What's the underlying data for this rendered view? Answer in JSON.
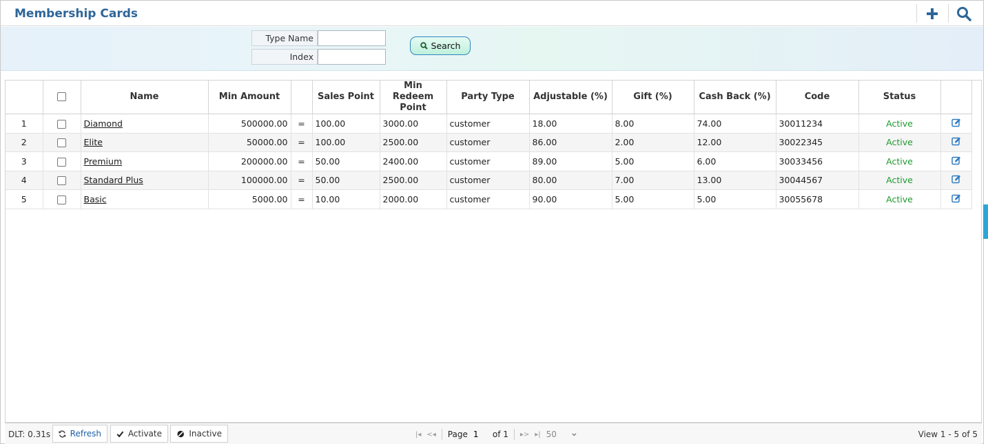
{
  "header": {
    "title": "Membership Cards",
    "add_icon": "plus-icon",
    "search_icon": "search-icon"
  },
  "search_panel": {
    "fields": [
      {
        "label": "Type Name",
        "value": ""
      },
      {
        "label": "Index",
        "value": ""
      }
    ],
    "search_button": "Search"
  },
  "table": {
    "columns": [
      "",
      "",
      "Name",
      "Min Amount",
      "",
      "Sales Point",
      "Min Redeem Point",
      "Party Type",
      "Adjustable (%)",
      "Gift (%)",
      "Cash Back (%)",
      "Code",
      "Status",
      ""
    ],
    "rows": [
      {
        "n": "1",
        "name": "Diamond",
        "min_amount": "500000.00",
        "eq": "=",
        "sales_point": "100.00",
        "min_redeem": "3000.00",
        "party_type": "customer",
        "adjustable": "18.00",
        "gift": "8.00",
        "cash_back": "74.00",
        "code": "30011234",
        "status": "Active"
      },
      {
        "n": "2",
        "name": "Elite",
        "min_amount": "50000.00",
        "eq": "=",
        "sales_point": "100.00",
        "min_redeem": "2500.00",
        "party_type": "customer",
        "adjustable": "86.00",
        "gift": "2.00",
        "cash_back": "12.00",
        "code": "30022345",
        "status": "Active"
      },
      {
        "n": "3",
        "name": "Premium",
        "min_amount": "200000.00",
        "eq": "=",
        "sales_point": "50.00",
        "min_redeem": "2400.00",
        "party_type": "customer",
        "adjustable": "89.00",
        "gift": "5.00",
        "cash_back": "6.00",
        "code": "30033456",
        "status": "Active"
      },
      {
        "n": "4",
        "name": "Standard Plus",
        "min_amount": "100000.00",
        "eq": "=",
        "sales_point": "50.00",
        "min_redeem": "2500.00",
        "party_type": "customer",
        "adjustable": "80.00",
        "gift": "7.00",
        "cash_back": "13.00",
        "code": "30044567",
        "status": "Active"
      },
      {
        "n": "5",
        "name": "Basic",
        "min_amount": "5000.00",
        "eq": "=",
        "sales_point": "10.00",
        "min_redeem": "2000.00",
        "party_type": "customer",
        "adjustable": "90.00",
        "gift": "5.00",
        "cash_back": "5.00",
        "code": "30055678",
        "status": "Active"
      }
    ]
  },
  "footer": {
    "dlt": "DLT: 0.31s",
    "refresh": "Refresh",
    "activate": "Activate",
    "inactive": "Inactive",
    "page_label": "Page",
    "page_value": "1",
    "of_label": "of 1",
    "rows_per_page": "50",
    "view_info": "View 1 - 5 of 5"
  },
  "colors": {
    "title": "#2e6699",
    "status_active": "#1c9a2c",
    "edit_icon": "#2f7bc4",
    "link_blue": "#1b5fa8"
  }
}
